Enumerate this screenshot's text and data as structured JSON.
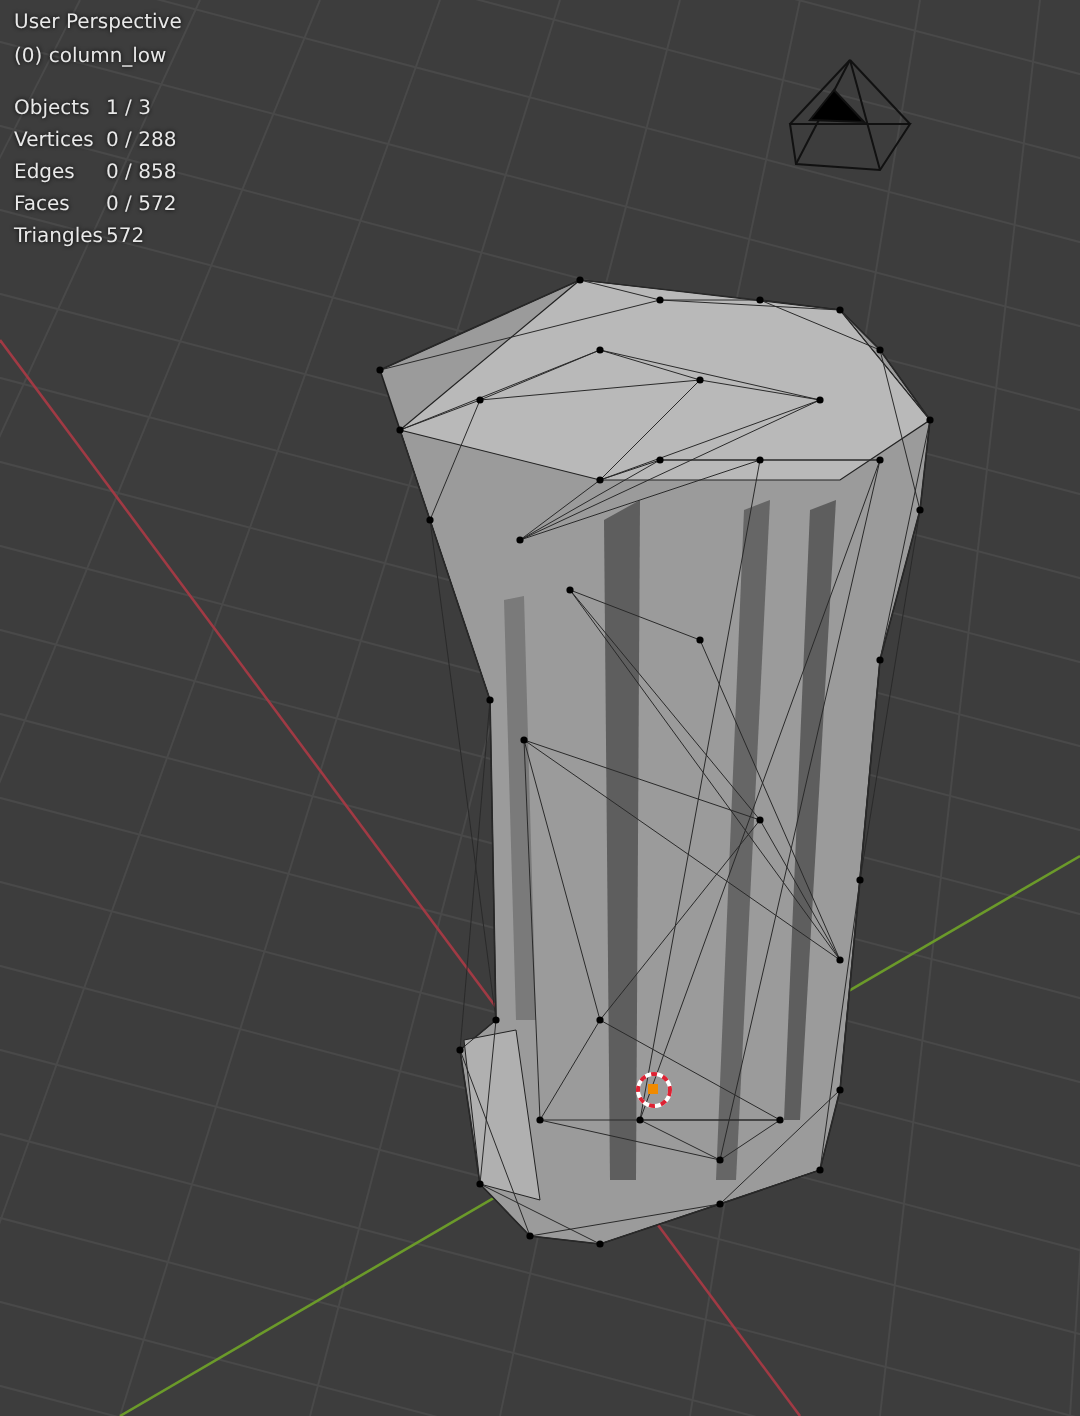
{
  "viewport": {
    "view_name": "User Perspective",
    "object_name": "(0) column_low",
    "stats": [
      {
        "label": "Objects",
        "value": "1 / 3"
      },
      {
        "label": "Vertices",
        "value": "0 / 288"
      },
      {
        "label": "Edges",
        "value": "0 / 858"
      },
      {
        "label": "Faces",
        "value": "0 / 572"
      },
      {
        "label": "Triangles",
        "value": "572"
      }
    ]
  }
}
